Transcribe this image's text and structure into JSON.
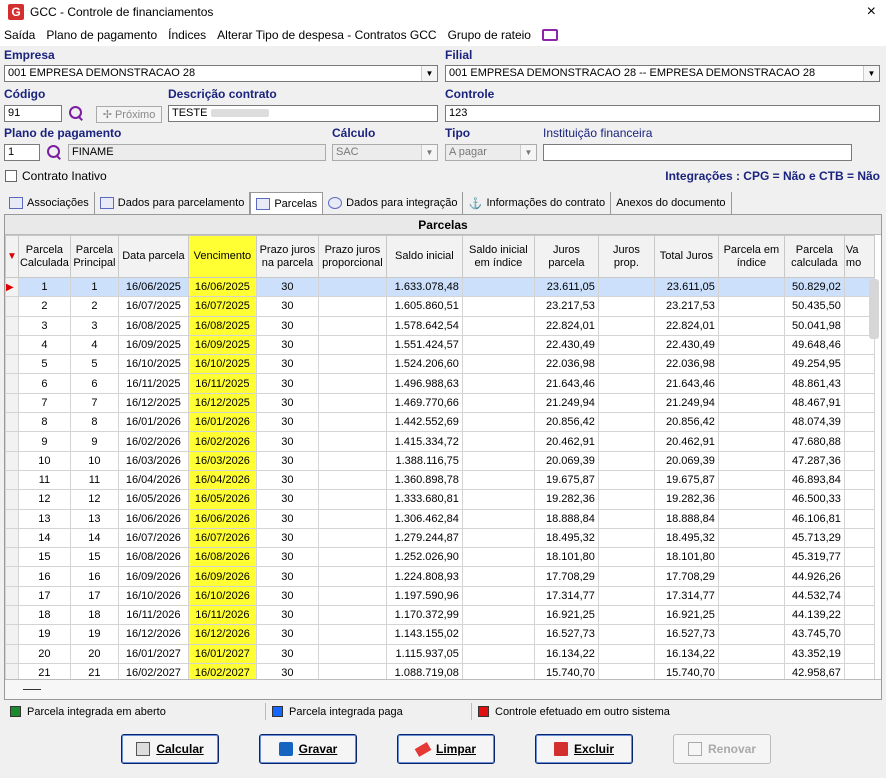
{
  "window": {
    "title": "GCC - Controle de financiamentos",
    "logo_letter": "G",
    "close": "×"
  },
  "menu": [
    "Saída",
    "Plano de pagamento",
    "Índices",
    "Alterar Tipo de despesa - Contratos GCC",
    "Grupo de rateio"
  ],
  "form": {
    "empresa_label": "Empresa",
    "empresa_value": "001 EMPRESA DEMONSTRACAO 28",
    "filial_label": "Filial",
    "filial_value": "001 EMPRESA DEMONSTRACAO 28 -- EMPRESA DEMONSTRACAO 28",
    "codigo_label": "Código",
    "codigo_value": "91",
    "proximo_label": "Próximo",
    "descricao_label": "Descrição contrato",
    "descricao_value": "TESTE",
    "controle_label": "Controle",
    "controle_value": "123",
    "plano_label": "Plano de pagamento",
    "plano_code": "1",
    "plano_name": "FINAME",
    "calculo_label": "Cálculo",
    "calculo_value": "SAC",
    "tipo_label": "Tipo",
    "tipo_value": "A pagar",
    "instituicao_label": "Instituição financeira",
    "instituicao_value": "",
    "inativo_label": "Contrato Inativo",
    "integracoes": "Integrações : CPG = Não e CTB = Não"
  },
  "tabs": [
    "Associações",
    "Dados para parcelamento",
    "Parcelas",
    "Dados para integração",
    "Informações do contrato",
    "Anexos do documento"
  ],
  "grid": {
    "title": "Parcelas",
    "columns": [
      "Parcela Calculada",
      "Parcela Principal",
      "Data parcela",
      "Vencimento",
      "Prazo juros na parcela",
      "Prazo juros proporcional",
      "Saldo inicial",
      "Saldo inicial em índice",
      "Juros parcela",
      "Juros prop.",
      "Total Juros",
      "Parcela em índice",
      "Parcela calculada",
      "Va mo"
    ],
    "rows": [
      [
        "1",
        "1",
        "16/06/2025",
        "16/06/2025",
        "30",
        "",
        "1.633.078,48",
        "",
        "23.611,05",
        "",
        "23.611,05",
        "",
        "50.829,02"
      ],
      [
        "2",
        "2",
        "16/07/2025",
        "16/07/2025",
        "30",
        "",
        "1.605.860,51",
        "",
        "23.217,53",
        "",
        "23.217,53",
        "",
        "50.435,50"
      ],
      [
        "3",
        "3",
        "16/08/2025",
        "16/08/2025",
        "30",
        "",
        "1.578.642,54",
        "",
        "22.824,01",
        "",
        "22.824,01",
        "",
        "50.041,98"
      ],
      [
        "4",
        "4",
        "16/09/2025",
        "16/09/2025",
        "30",
        "",
        "1.551.424,57",
        "",
        "22.430,49",
        "",
        "22.430,49",
        "",
        "49.648,46"
      ],
      [
        "5",
        "5",
        "16/10/2025",
        "16/10/2025",
        "30",
        "",
        "1.524.206,60",
        "",
        "22.036,98",
        "",
        "22.036,98",
        "",
        "49.254,95"
      ],
      [
        "6",
        "6",
        "16/11/2025",
        "16/11/2025",
        "30",
        "",
        "1.496.988,63",
        "",
        "21.643,46",
        "",
        "21.643,46",
        "",
        "48.861,43"
      ],
      [
        "7",
        "7",
        "16/12/2025",
        "16/12/2025",
        "30",
        "",
        "1.469.770,66",
        "",
        "21.249,94",
        "",
        "21.249,94",
        "",
        "48.467,91"
      ],
      [
        "8",
        "8",
        "16/01/2026",
        "16/01/2026",
        "30",
        "",
        "1.442.552,69",
        "",
        "20.856,42",
        "",
        "20.856,42",
        "",
        "48.074,39"
      ],
      [
        "9",
        "9",
        "16/02/2026",
        "16/02/2026",
        "30",
        "",
        "1.415.334,72",
        "",
        "20.462,91",
        "",
        "20.462,91",
        "",
        "47.680,88"
      ],
      [
        "10",
        "10",
        "16/03/2026",
        "16/03/2026",
        "30",
        "",
        "1.388.116,75",
        "",
        "20.069,39",
        "",
        "20.069,39",
        "",
        "47.287,36"
      ],
      [
        "11",
        "11",
        "16/04/2026",
        "16/04/2026",
        "30",
        "",
        "1.360.898,78",
        "",
        "19.675,87",
        "",
        "19.675,87",
        "",
        "46.893,84"
      ],
      [
        "12",
        "12",
        "16/05/2026",
        "16/05/2026",
        "30",
        "",
        "1.333.680,81",
        "",
        "19.282,36",
        "",
        "19.282,36",
        "",
        "46.500,33"
      ],
      [
        "13",
        "13",
        "16/06/2026",
        "16/06/2026",
        "30",
        "",
        "1.306.462,84",
        "",
        "18.888,84",
        "",
        "18.888,84",
        "",
        "46.106,81"
      ],
      [
        "14",
        "14",
        "16/07/2026",
        "16/07/2026",
        "30",
        "",
        "1.279.244,87",
        "",
        "18.495,32",
        "",
        "18.495,32",
        "",
        "45.713,29"
      ],
      [
        "15",
        "15",
        "16/08/2026",
        "16/08/2026",
        "30",
        "",
        "1.252.026,90",
        "",
        "18.101,80",
        "",
        "18.101,80",
        "",
        "45.319,77"
      ],
      [
        "16",
        "16",
        "16/09/2026",
        "16/09/2026",
        "30",
        "",
        "1.224.808,93",
        "",
        "17.708,29",
        "",
        "17.708,29",
        "",
        "44.926,26"
      ],
      [
        "17",
        "17",
        "16/10/2026",
        "16/10/2026",
        "30",
        "",
        "1.197.590,96",
        "",
        "17.314,77",
        "",
        "17.314,77",
        "",
        "44.532,74"
      ],
      [
        "18",
        "18",
        "16/11/2026",
        "16/11/2026",
        "30",
        "",
        "1.170.372,99",
        "",
        "16.921,25",
        "",
        "16.921,25",
        "",
        "44.139,22"
      ],
      [
        "19",
        "19",
        "16/12/2026",
        "16/12/2026",
        "30",
        "",
        "1.143.155,02",
        "",
        "16.527,73",
        "",
        "16.527,73",
        "",
        "43.745,70"
      ],
      [
        "20",
        "20",
        "16/01/2027",
        "16/01/2027",
        "30",
        "",
        "1.115.937,05",
        "",
        "16.134,22",
        "",
        "16.134,22",
        "",
        "43.352,19"
      ],
      [
        "21",
        "21",
        "16/02/2027",
        "16/02/2027",
        "30",
        "",
        "1.088.719,08",
        "",
        "15.740,70",
        "",
        "15.740,70",
        "",
        "42.958,67"
      ]
    ]
  },
  "legend": [
    {
      "label": "Parcela integrada em aberto",
      "color": "#1b8a2e"
    },
    {
      "label": "Parcela integrada paga",
      "color": "#1565ff"
    },
    {
      "label": "Controle efetuado em outro sistema",
      "color": "#e01010"
    }
  ],
  "buttons": {
    "calcular": "Calcular",
    "gravar": "Gravar",
    "limpar": "Limpar",
    "excluir": "Excluir",
    "renovar": "Renovar"
  }
}
